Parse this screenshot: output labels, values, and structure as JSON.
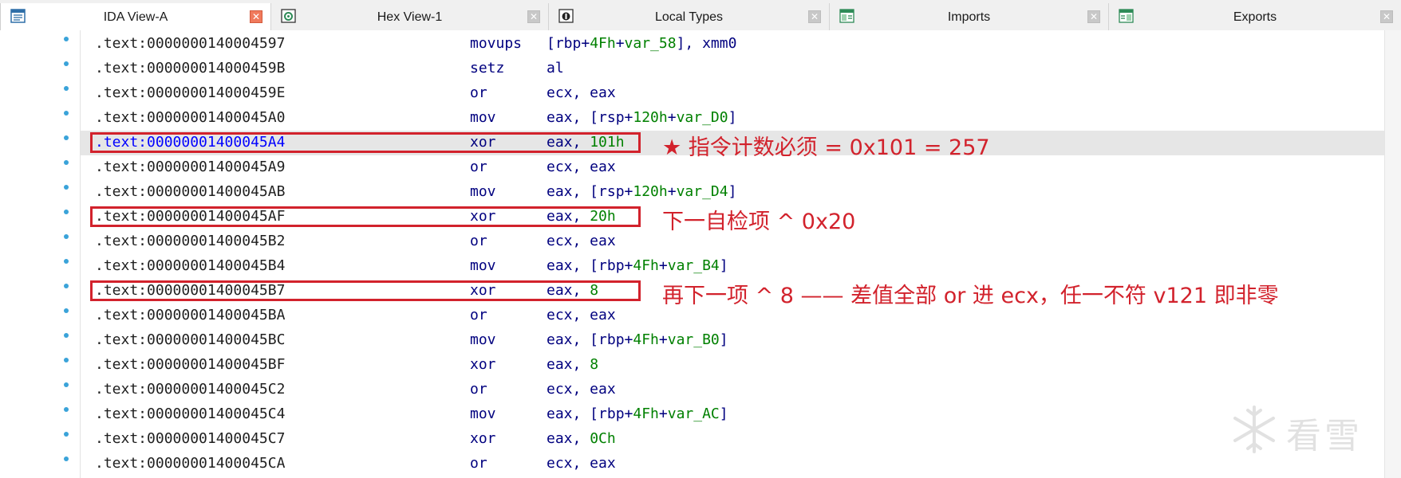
{
  "tabs": [
    {
      "label": "IDA View-A",
      "icon": "ida-view-icon",
      "active": true
    },
    {
      "label": "Hex View-1",
      "icon": "hex-view-icon",
      "active": false
    },
    {
      "label": "Local Types",
      "icon": "local-types-icon",
      "active": false
    },
    {
      "label": "Imports",
      "icon": "imports-icon",
      "active": false
    },
    {
      "label": "Exports",
      "icon": "exports-icon",
      "active": false
    }
  ],
  "close_glyph": "✕",
  "lines": [
    {
      "addr": ".text:0000000140004597",
      "mnem": "movups",
      "ops": [
        [
          "reg",
          "[rbp+"
        ],
        [
          "num",
          "4Fh"
        ],
        [
          "reg",
          "+"
        ],
        [
          "var",
          "var_58"
        ],
        [
          "reg",
          "], xmm0"
        ]
      ]
    },
    {
      "addr": ".text:000000014000459B",
      "mnem": "setz",
      "ops": [
        [
          "reg",
          "al"
        ]
      ]
    },
    {
      "addr": ".text:000000014000459E",
      "mnem": "or",
      "ops": [
        [
          "reg",
          "ecx, eax"
        ]
      ]
    },
    {
      "addr": ".text:00000001400045A0",
      "mnem": "mov",
      "ops": [
        [
          "reg",
          "eax, [rsp+"
        ],
        [
          "num",
          "120h"
        ],
        [
          "reg",
          "+"
        ],
        [
          "var",
          "var_D0"
        ],
        [
          "reg",
          "]"
        ]
      ]
    },
    {
      "addr": ".text:00000001400045A4",
      "mnem": "xor",
      "ops": [
        [
          "reg",
          "eax, "
        ],
        [
          "num",
          "101h"
        ]
      ],
      "highlight": true
    },
    {
      "addr": ".text:00000001400045A9",
      "mnem": "or",
      "ops": [
        [
          "reg",
          "ecx, eax"
        ]
      ]
    },
    {
      "addr": ".text:00000001400045AB",
      "mnem": "mov",
      "ops": [
        [
          "reg",
          "eax, [rsp+"
        ],
        [
          "num",
          "120h"
        ],
        [
          "reg",
          "+"
        ],
        [
          "var",
          "var_D4"
        ],
        [
          "reg",
          "]"
        ]
      ]
    },
    {
      "addr": ".text:00000001400045AF",
      "mnem": "xor",
      "ops": [
        [
          "reg",
          "eax, "
        ],
        [
          "num",
          "20h"
        ]
      ]
    },
    {
      "addr": ".text:00000001400045B2",
      "mnem": "or",
      "ops": [
        [
          "reg",
          "ecx, eax"
        ]
      ]
    },
    {
      "addr": ".text:00000001400045B4",
      "mnem": "mov",
      "ops": [
        [
          "reg",
          "eax, [rbp+"
        ],
        [
          "num",
          "4Fh"
        ],
        [
          "reg",
          "+"
        ],
        [
          "var",
          "var_B4"
        ],
        [
          "reg",
          "]"
        ]
      ]
    },
    {
      "addr": ".text:00000001400045B7",
      "mnem": "xor",
      "ops": [
        [
          "reg",
          "eax, "
        ],
        [
          "num",
          "8"
        ]
      ]
    },
    {
      "addr": ".text:00000001400045BA",
      "mnem": "or",
      "ops": [
        [
          "reg",
          "ecx, eax"
        ]
      ]
    },
    {
      "addr": ".text:00000001400045BC",
      "mnem": "mov",
      "ops": [
        [
          "reg",
          "eax, [rbp+"
        ],
        [
          "num",
          "4Fh"
        ],
        [
          "reg",
          "+"
        ],
        [
          "var",
          "var_B0"
        ],
        [
          "reg",
          "]"
        ]
      ]
    },
    {
      "addr": ".text:00000001400045BF",
      "mnem": "xor",
      "ops": [
        [
          "reg",
          "eax, "
        ],
        [
          "num",
          "8"
        ]
      ]
    },
    {
      "addr": ".text:00000001400045C2",
      "mnem": "or",
      "ops": [
        [
          "reg",
          "ecx, eax"
        ]
      ]
    },
    {
      "addr": ".text:00000001400045C4",
      "mnem": "mov",
      "ops": [
        [
          "reg",
          "eax, [rbp+"
        ],
        [
          "num",
          "4Fh"
        ],
        [
          "reg",
          "+"
        ],
        [
          "var",
          "var_AC"
        ],
        [
          "reg",
          "]"
        ]
      ]
    },
    {
      "addr": ".text:00000001400045C7",
      "mnem": "xor",
      "ops": [
        [
          "reg",
          "eax, "
        ],
        [
          "num",
          "0Ch"
        ]
      ]
    },
    {
      "addr": ".text:00000001400045CA",
      "mnem": "or",
      "ops": [
        [
          "reg",
          "ecx, eax"
        ]
      ]
    }
  ],
  "annotations": [
    {
      "line": 4,
      "text": "★ 指令计数必须 = 0x101 = 257"
    },
    {
      "line": 7,
      "text": "下一自检项 ^ 0x20"
    },
    {
      "line": 10,
      "text": "再下一项 ^ 8 —— 差值全部 or 进 ecx，任一不符 v121 即非零"
    }
  ],
  "watermark": {
    "text": "看雪",
    "icon": "snowflake-icon"
  },
  "colors": {
    "annotation_red": "#d2222c",
    "address_highlight": "#0000ff",
    "mnemonic": "#00007f",
    "number": "#008000",
    "breakpoint_dot": "#3aa3d9"
  }
}
